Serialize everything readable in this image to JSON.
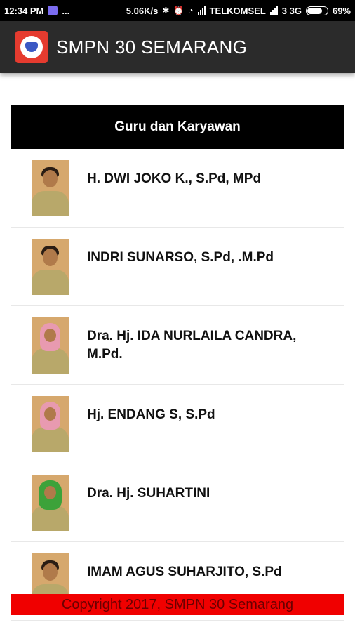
{
  "status_bar": {
    "time": "12:34 PM",
    "more": "...",
    "speed": "5.06K/s",
    "carrier": "TELKOMSEL",
    "network": "3 3G",
    "battery": "69%",
    "battery_level": 0.69
  },
  "app_bar": {
    "title": "SMPN 30 SEMARANG",
    "logo_icon": "school-crest-icon"
  },
  "section": {
    "title": "Guru dan Karyawan"
  },
  "staff": [
    {
      "name": "H. DWI JOKO K., S.Pd, MPd"
    },
    {
      "name": "INDRI SUNARSO, S.Pd, .M.Pd"
    },
    {
      "name": "Dra. Hj. IDA NURLAILA CANDRA, M.Pd."
    },
    {
      "name": "Hj. ENDANG S, S.Pd"
    },
    {
      "name": "Dra. Hj. SUHARTINI"
    },
    {
      "name": "IMAM AGUS SUHARJITO, S.Pd"
    }
  ],
  "footer": {
    "text": "Copyright 2017, SMPN 30 Semarang"
  },
  "colors": {
    "app_bar": "#2b2b2b",
    "section_header": "#000000",
    "footer_bg": "#f00000",
    "footer_text": "#6a0000"
  }
}
